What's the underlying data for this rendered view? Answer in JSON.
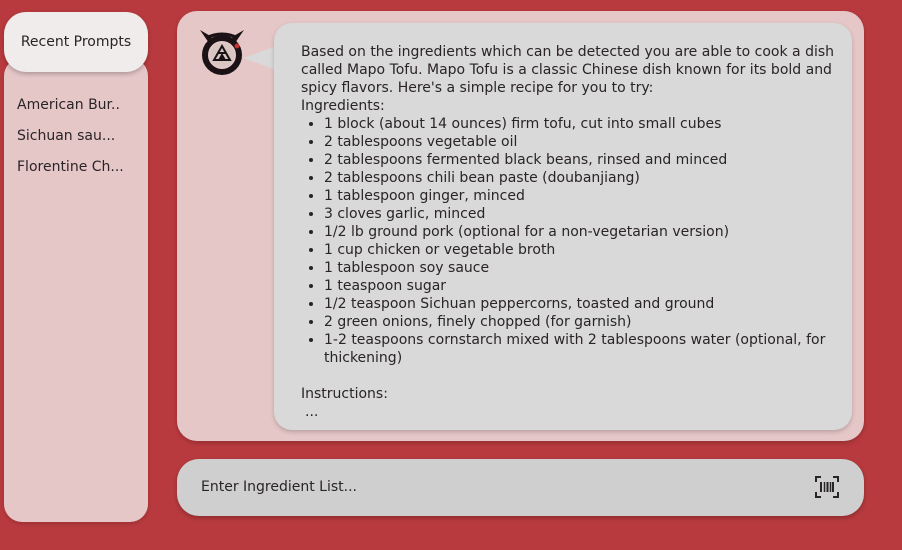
{
  "sidebar": {
    "header_label": "Recent Prompts",
    "items": [
      {
        "label": "American Bur.."
      },
      {
        "label": "Sichuan sau..."
      },
      {
        "label": "Florentine Ch..."
      }
    ]
  },
  "chat": {
    "intro": "Based on the ingredients which can be detected you are able to cook a dish called Mapo Tofu. Mapo Tofu is a classic Chinese dish known for its bold and spicy flavors. Here's a simple recipe for you to try:",
    "ingredients_label": "Ingredients:",
    "ingredients": [
      "1 block (about 14 ounces) firm tofu, cut into small cubes",
      "2 tablespoons vegetable oil",
      "2 tablespoons fermented black beans, rinsed and minced",
      "2 tablespoons chili bean paste (doubanjiang)",
      "1 tablespoon ginger, minced",
      "3 cloves garlic, minced",
      "1/2 lb ground pork (optional for a non-vegetarian version)",
      "1 cup chicken or vegetable broth",
      "1 tablespoon soy sauce",
      "1 teaspoon sugar",
      "1/2 teaspoon Sichuan peppercorns, toasted and ground",
      "2 green onions, finely chopped (for garnish)",
      "1-2 teaspoons cornstarch mixed with 2 tablespoons water (optional, for thickening)"
    ],
    "instructions_label": "Instructions:",
    "instructions_ellipsis": "..."
  },
  "input": {
    "placeholder": "Enter Ingredient List..."
  },
  "icons": {
    "avatar": "ouroboros-emblem-icon",
    "scan": "barcode-scan-icon"
  },
  "colors": {
    "background": "#b83a3e",
    "panel": "#e6c7c8",
    "bubble": "#d9d9d9",
    "input": "#cfcfcf",
    "header": "#f0ecec"
  }
}
